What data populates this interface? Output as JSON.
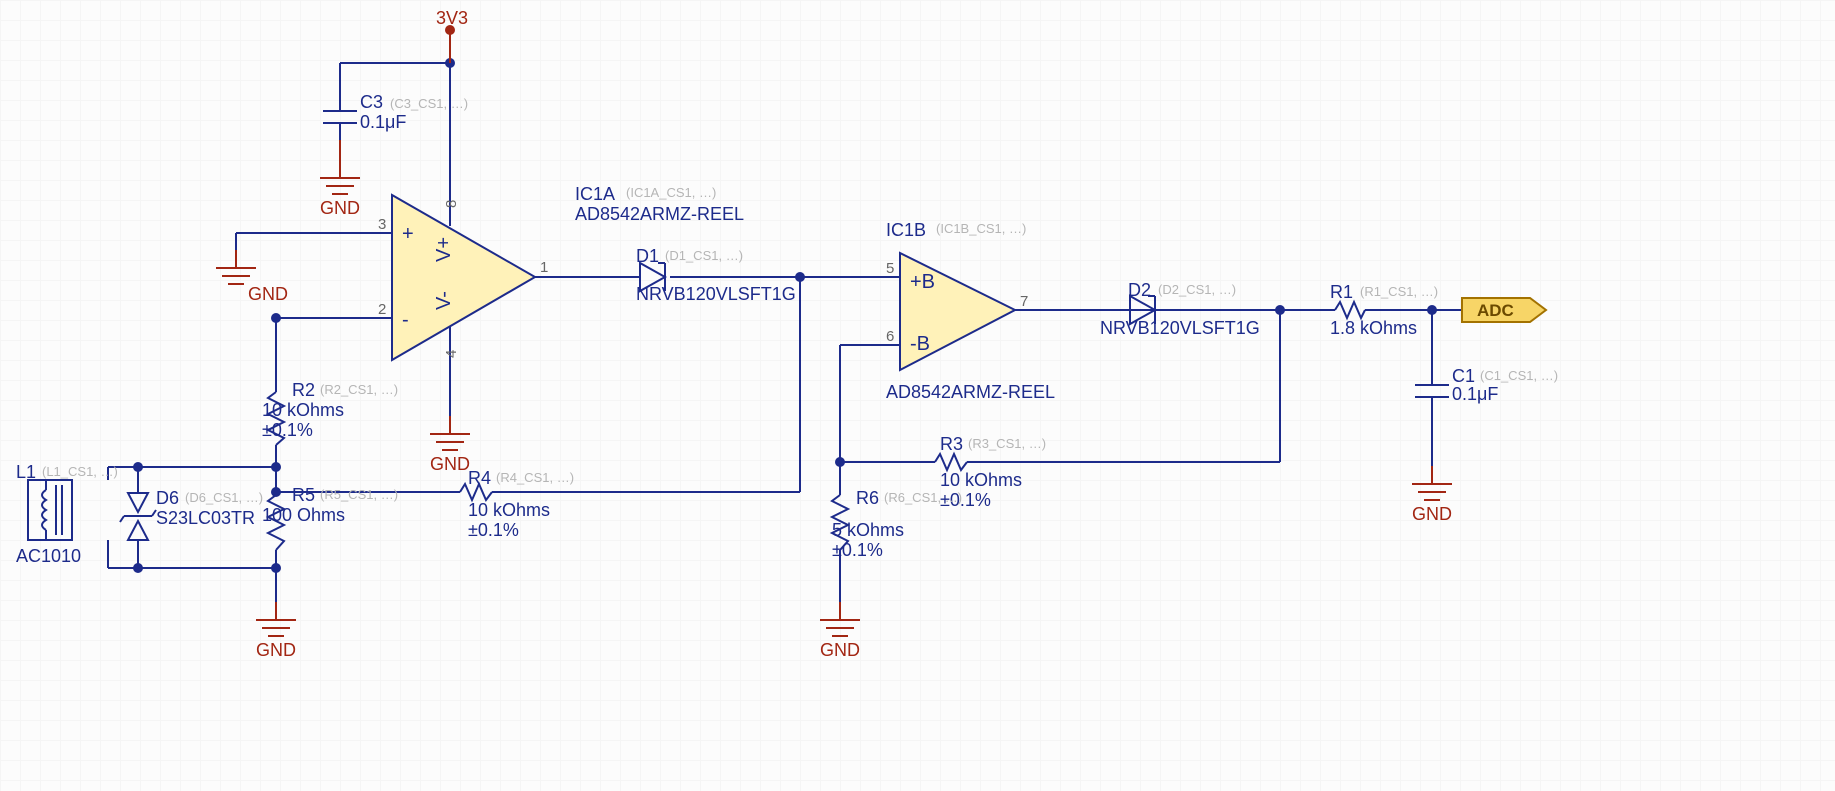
{
  "power": {
    "rail": "3V3",
    "gnd": "GND"
  },
  "port": {
    "label": "ADC"
  },
  "ic1a": {
    "ref": "IC1A",
    "val": "AD8542ARMZ-REEL",
    "ann": "(IC1A_CS1, …)",
    "pin1": "1",
    "pin2": "2",
    "pin3": "3",
    "pin4": "4",
    "pin8": "8",
    "plus": "+",
    "minus": "-",
    "vplus": "V+",
    "vminus": "V-"
  },
  "ic1b": {
    "ref": "IC1B",
    "val": "AD8542ARMZ-REEL",
    "ann": "(IC1B_CS1, …)",
    "pin5": "5",
    "pin6": "6",
    "pin7": "7",
    "plus": "+B",
    "minus": "-B"
  },
  "c1": {
    "ref": "C1",
    "val": "0.1μF",
    "ann": "(C1_CS1, …)"
  },
  "c3": {
    "ref": "C3",
    "val": "0.1μF",
    "ann": "(C3_CS1, …)"
  },
  "d1": {
    "ref": "D1",
    "val": "NRVB120VLSFT1G",
    "ann": "(D1_CS1, …)"
  },
  "d2": {
    "ref": "D2",
    "val": "NRVB120VLSFT1G",
    "ann": "(D2_CS1, …)"
  },
  "d6": {
    "ref": "D6",
    "val": "S23LC03TR",
    "ann": "(D6_CS1, …)"
  },
  "l1": {
    "ref": "L1",
    "val": "AC1010",
    "ann": "(L1_CS1, …)"
  },
  "r1": {
    "ref": "R1",
    "val": "1.8 kOhms",
    "ann": "(R1_CS1, …)"
  },
  "r2": {
    "ref": "R2",
    "val": "10 kOhms",
    "tol": "±0.1%",
    "ann": "(R2_CS1, …)"
  },
  "r3": {
    "ref": "R3",
    "val": "10 kOhms",
    "tol": "±0.1%",
    "ann": "(R3_CS1, …)"
  },
  "r4": {
    "ref": "R4",
    "val": "10 kOhms",
    "tol": "±0.1%",
    "ann": "(R4_CS1, …)"
  },
  "r5": {
    "ref": "R5",
    "val": "100 Ohms",
    "ann": "(R5_CS1, …)"
  },
  "r6": {
    "ref": "R6",
    "val": "5 kOhms",
    "tol": "±0.1%",
    "ann": "(R6_CS1, …)"
  }
}
